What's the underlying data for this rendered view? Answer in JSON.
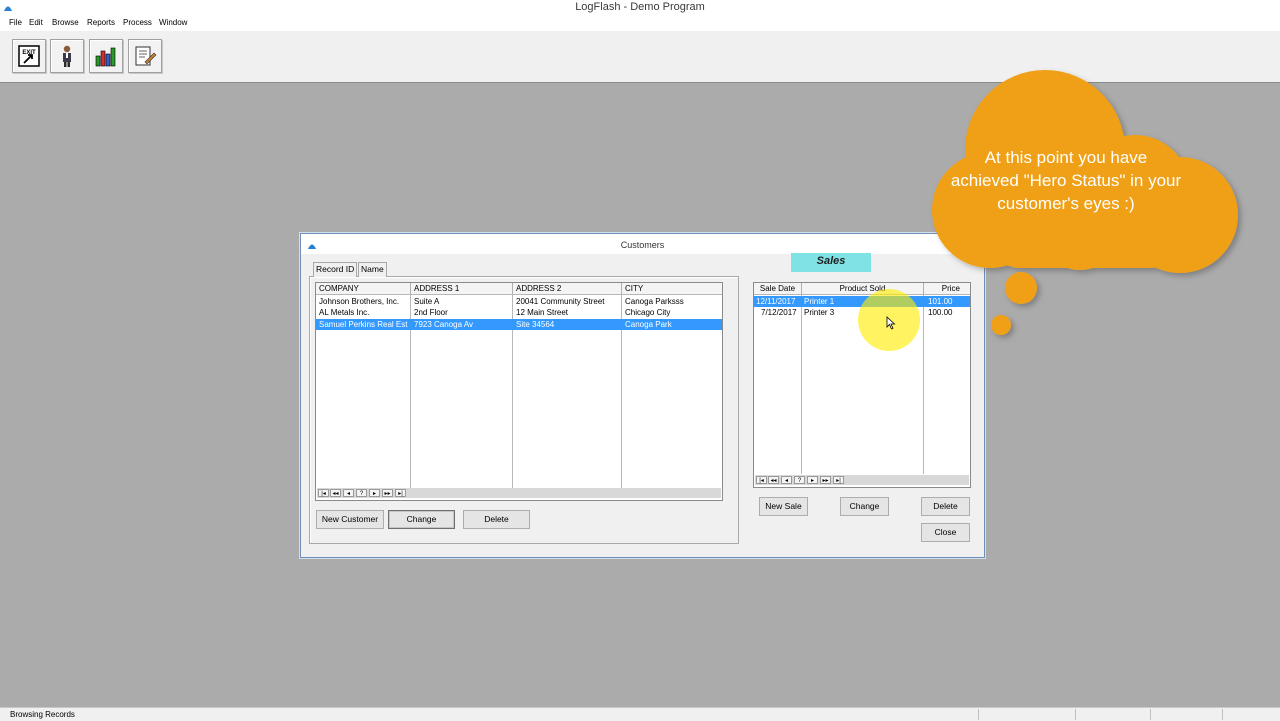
{
  "window": {
    "title": "LogFlash - Demo Program"
  },
  "menu": [
    "File",
    "Edit",
    "Browse",
    "Reports",
    "Process",
    "Window"
  ],
  "toolbar": {
    "exit_label": "EXIT",
    "icons": [
      "exit-icon",
      "person-icon",
      "bar-chart-icon",
      "document-edit-icon"
    ]
  },
  "dialog": {
    "title": "Customers",
    "tabs": [
      "Record ID",
      "Name"
    ],
    "customers": {
      "columns": [
        "COMPANY",
        "ADDRESS 1",
        "ADDRESS 2",
        "CITY"
      ],
      "rows": [
        [
          "Johnson Brothers, Inc.",
          "Suite A",
          "20041 Community Street",
          "Canoga Parksss"
        ],
        [
          "AL Metals Inc.",
          "2nd Floor",
          "12 Main Street",
          "Chicago City"
        ],
        [
          "Samuel Perkins Real Est",
          "7923 Canoga Av",
          "Site 34564",
          "Canoga Park"
        ]
      ],
      "selected_row": 2
    },
    "customer_buttons": {
      "new": "New Customer",
      "change": "Change",
      "delete": "Delete"
    },
    "sales_label": "Sales",
    "sales": {
      "columns": [
        "Sale Date",
        "Product Sold",
        "Price"
      ],
      "rows": [
        [
          "12/11/2017",
          "Printer 1",
          "101.00"
        ],
        [
          "7/12/2017",
          "Printer 3",
          "100.00"
        ]
      ],
      "selected_row": 0
    },
    "sales_buttons": {
      "new": "New Sale",
      "change": "Change",
      "delete": "Delete",
      "close": "Close"
    },
    "nav_buttons": [
      "|◂",
      "◂◂",
      "◂",
      "?",
      "▸",
      "▸▸",
      "▸|"
    ]
  },
  "callout": {
    "text": "At this point you have achieved \"Hero Status\" in your customer's eyes :)",
    "color": "#f0a019"
  },
  "status": {
    "text": "Browsing Records"
  }
}
